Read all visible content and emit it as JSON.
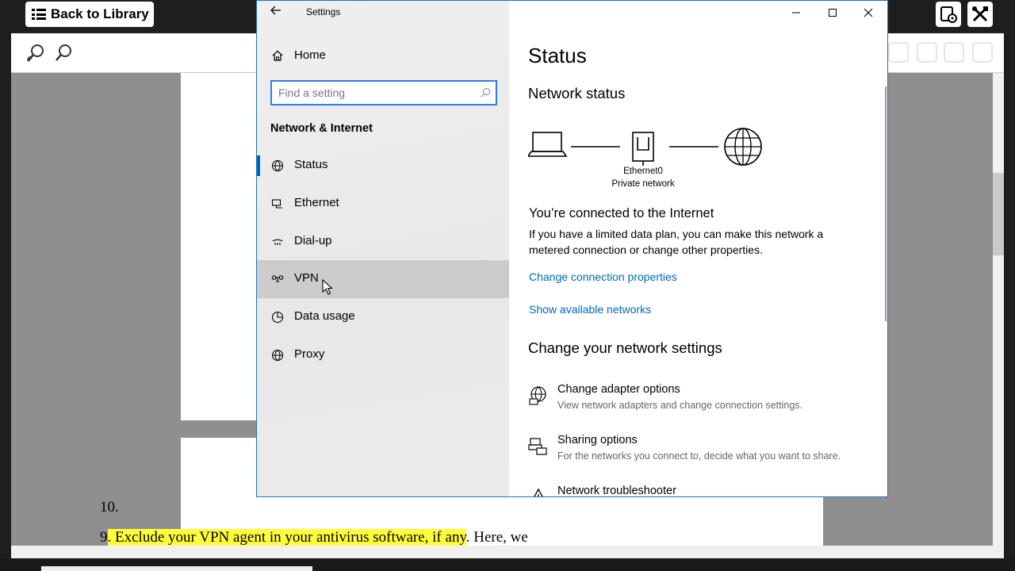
{
  "reader": {
    "back_label": "Back to Library",
    "document_lines": [
      "10.",
      ". Exclude your VPN agent in your antivirus software, if any",
      ". Here, we"
    ],
    "line_number_9": "9"
  },
  "settings": {
    "title": "Settings",
    "home_label": "Home",
    "search_placeholder": "Find a setting",
    "section": "Network & Internet",
    "nav": [
      {
        "label": "Status",
        "icon": "globe-status-icon",
        "active": true
      },
      {
        "label": "Ethernet",
        "icon": "ethernet-icon"
      },
      {
        "label": "Dial-up",
        "icon": "dialup-icon"
      },
      {
        "label": "VPN",
        "icon": "vpn-icon",
        "hover": true
      },
      {
        "label": "Data usage",
        "icon": "data-usage-icon"
      },
      {
        "label": "Proxy",
        "icon": "proxy-globe-icon"
      }
    ],
    "content": {
      "title": "Status",
      "network_status_heading": "Network status",
      "adapter_name": "Ethernet0",
      "network_type": "Private network",
      "connected_heading": "You’re connected to the Internet",
      "connected_description": "If you have a limited data plan, you can make this network a metered connection or change other properties.",
      "link_change_properties": "Change connection properties",
      "link_show_networks": "Show available networks",
      "change_settings_heading": "Change your network settings",
      "options": [
        {
          "title": "Change adapter options",
          "subtitle": "View network adapters and change connection settings.",
          "icon": "adapter-icon"
        },
        {
          "title": "Sharing options",
          "subtitle": "For the networks you connect to, decide what you want to share.",
          "icon": "sharing-icon"
        },
        {
          "title": "Network troubleshooter",
          "subtitle": "",
          "icon": "troubleshooter-icon"
        }
      ]
    },
    "accent_color": "#0063b1",
    "link_color": "#0067b8"
  }
}
